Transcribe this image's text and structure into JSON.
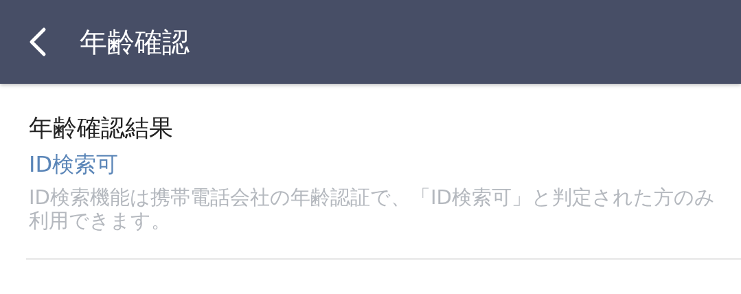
{
  "header": {
    "title": "年齢確認"
  },
  "section": {
    "title": "年齢確認結果",
    "result": "ID検索可",
    "description": "ID検索機能は携帯電話会社の年齢認証で、「ID検索可」と判定された方のみ利用できます。"
  }
}
